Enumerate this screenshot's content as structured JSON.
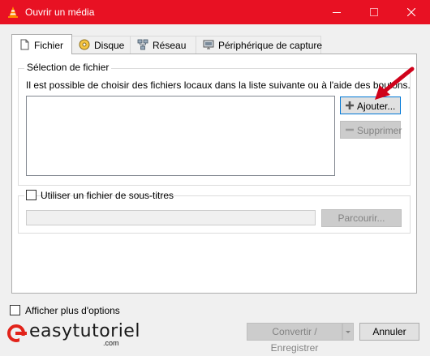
{
  "window": {
    "title": "Ouvrir un média",
    "title_bar_color": "#e81123"
  },
  "tabs": [
    {
      "label": "Fichier",
      "icon": "file-icon",
      "active": true
    },
    {
      "label": "Disque",
      "icon": "disc-icon",
      "active": false
    },
    {
      "label": "Réseau",
      "icon": "network-icon",
      "active": false
    },
    {
      "label": "Périphérique de capture",
      "icon": "capture-device-icon",
      "active": false
    }
  ],
  "file_selection": {
    "group_title": "Sélection de fichier",
    "description": "Il est possible de choisir des fichiers locaux dans la liste suivante ou à l'aide des boutons.",
    "add_button": "Ajouter...",
    "remove_button": "Supprimer"
  },
  "subtitles": {
    "checkbox_label": "Utiliser un fichier de sous-titres",
    "checked": false,
    "path_value": "",
    "browse_button": "Parcourir..."
  },
  "footer": {
    "more_options_label": "Afficher plus d'options",
    "convert_button": "Convertir / Enregistrer",
    "cancel_button": "Annuler"
  },
  "watermark": {
    "text": "easytutoriel",
    "domain": ".com",
    "accent_color": "#e2231a"
  },
  "accent_color": "#0078d7"
}
